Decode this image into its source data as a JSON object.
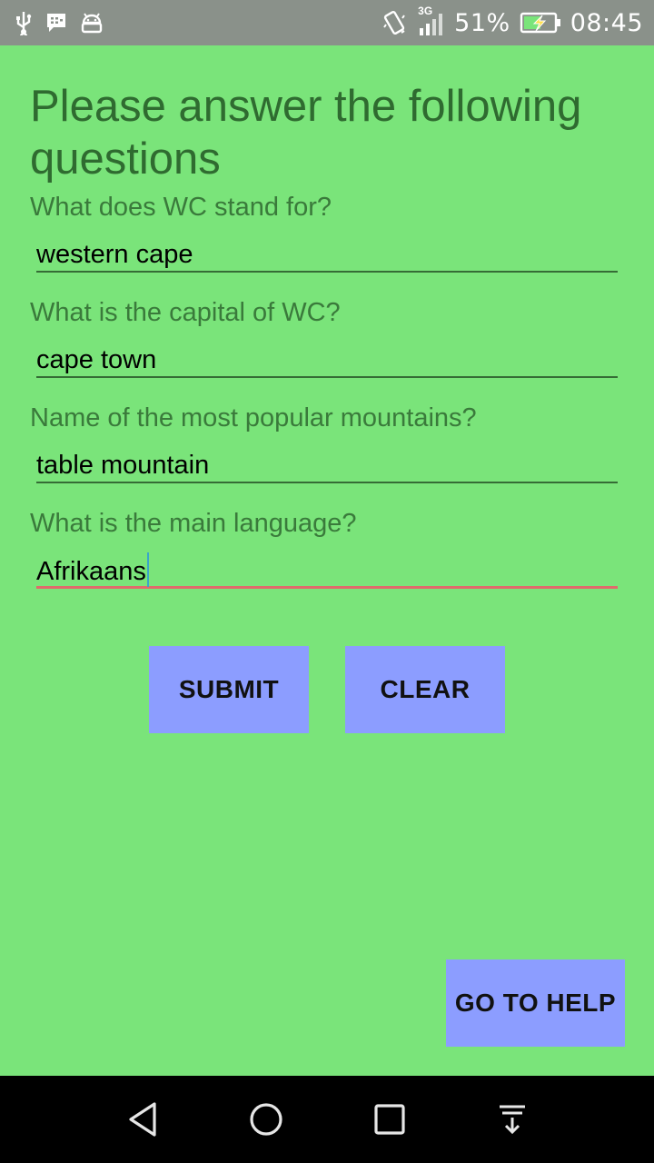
{
  "status_bar": {
    "network_type": "3G",
    "battery_percent": "51%",
    "time": "08:45",
    "icons": [
      "usb-icon",
      "bbm-icon",
      "android-icon",
      "vibrate-icon",
      "signal-icon",
      "battery-charging-icon"
    ]
  },
  "form": {
    "title": "Please answer the following questions",
    "questions": [
      {
        "label": "What does WC stand for?",
        "value": "western cape"
      },
      {
        "label": "What is the capital of WC?",
        "value": "cape town"
      },
      {
        "label": "Name of the most popular mountains?",
        "value": "table mountain"
      },
      {
        "label": "What is the main language?",
        "value": "Afrikaans"
      }
    ]
  },
  "buttons": {
    "submit": "SUBMIT",
    "clear": "CLEAR",
    "help": "GO TO HELP"
  },
  "colors": {
    "background": "#7ae47a",
    "button": "#8c9dff",
    "text_green": "#3a7a3b"
  }
}
